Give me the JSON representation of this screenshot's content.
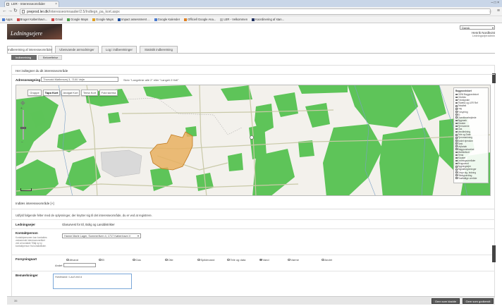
{
  "browser": {
    "tab_title": "LER - Interesseområder",
    "tab_close": "×",
    "window_controls": "–  □  ×",
    "url_host": "preprod.ler.dk",
    "url_path": "/Interesseomraader/2.5/Indtegn_pa_kort.aspx",
    "star": "☆",
    "menu": "≡",
    "bookmarks": [
      {
        "label": "Apps",
        "color": "#4a7bd0"
      },
      {
        "label": "Bruger København...",
        "color": "#d04a4a"
      },
      {
        "label": "Gmail",
        "color": "#d04a4a"
      },
      {
        "label": "Google Maps",
        "color": "#4aa04a"
      },
      {
        "label": "Google Maps",
        "color": "#e0a020"
      },
      {
        "label": "Impact assessment ...",
        "color": "#2050a0"
      },
      {
        "label": "Google Kalender",
        "color": "#4a7bd0"
      },
      {
        "label": "Officiell Google Ana...",
        "color": "#e08020"
      },
      {
        "label": "LER - Velkommen",
        "color": "#bbbbbb"
      },
      {
        "label": "Koordinering af stan...",
        "color": "#203060"
      }
    ]
  },
  "header": {
    "logo_text": "Ledningsejere",
    "language": "Dansk",
    "user_name": "Henrik Nordkvist",
    "user_role": "Ledningsejeradmin"
  },
  "main_tabs": [
    {
      "label": "Indberetning af interesseområder",
      "active": true
    },
    {
      "label": "Ubesvarede anmodninger",
      "active": false
    },
    {
      "label": "Log i indberetninger",
      "active": false
    },
    {
      "label": "Statistik indberetning",
      "active": false
    }
  ],
  "steps": [
    {
      "label": "Indberetning",
      "state": "done"
    },
    {
      "label": "Bekræftelse",
      "state": "current"
    }
  ],
  "page": {
    "instruction": "Her indtegner du dit interesseområde",
    "address_label": "Adressesøgning",
    "address_value": "Thorvald Møllersvej 3, 7100 Vejle",
    "address_hint": "Skriv \"Langelinie allé 2\" eller \"Langeli 2 Hell\"",
    "show_areas": "Indlæs interesseområde [+]",
    "info_text": "Udfyld følgende felter med de oplysninger, der knytter sig til det interesseområde, du er ved at registrere."
  },
  "map": {
    "types": [
      "Gruppe",
      "Topo Kort",
      "Andgat Kort",
      "Tema Kort",
      "Fold skema"
    ],
    "active_type": "Topo Kort",
    "pan_icon": "✥",
    "zoom_plus": "+",
    "zoom_minus": "−",
    "zoom_level": 0.4,
    "layers_header": "Baggrundskort",
    "layers_header2": "Lag",
    "layers": [
      "GDW Baggrundskort",
      "Ortofoto",
      "Fotosignale",
      "Tilvæks og LER Ref",
      "Tekstfelt",
      "Lag",
      "Forsyning",
      "El",
      "Grøntforarbejdede",
      "Bygmark",
      "Kloaker",
      "Fjernvarme",
      "Gas",
      "Vandledning",
      "Tele og Data",
      "Fjernmarkning",
      "Andet ejendom",
      "Tank",
      "Vejforløb",
      "Baggrundsvekst",
      "Matrikelkort",
      "Tema",
      "Kloaker",
      "Ledningsområder",
      "Brugsvand",
      "Bygningsejer",
      "Signalforgreninger",
      "Drivpr sig. ledning",
      "Rådsgrundlag",
      "Rustfattige område"
    ]
  },
  "form": {
    "owner_label": "Ledningsejer",
    "owner_value": "Glasurvest for El, Bolig og Landdistrikter",
    "contact_label": "Kontaktperson",
    "contact_desc": "Kontaktpersonen kan kontaktes vedrørende interesseområdet ved at kontakte Tilføj ny ny kontaktperson fra kontaktlisten",
    "contact_value": "Hanne Marie Lager, Sommerliven 4, 1717 København V",
    "supply_label": "Forsyningsart",
    "supply_options": [
      {
        "label": "Afvand",
        "selected": false
      },
      {
        "label": "El",
        "selected": false
      },
      {
        "label": "Gas",
        "selected": false
      },
      {
        "label": "Olie",
        "selected": false
      },
      {
        "label": "Spildevand",
        "selected": false
      },
      {
        "label": "Tele og data",
        "selected": false
      },
      {
        "label": "Vand",
        "selected": true
      },
      {
        "label": "Varme",
        "selected": false
      },
      {
        "label": "Andet",
        "selected": false
      }
    ],
    "other_label": "Andet",
    "remarks_label": "Bemærkninger",
    "remarks_value": "Hvidmand / Lauf ved d"
  },
  "footer": {
    "page_index": "35",
    "save_draft": "Gem som kladde",
    "save_final": "Gem som godkendt"
  },
  "colors": {
    "forest": "#5ec459",
    "field": "#f3f1ec",
    "area": "#e8b060",
    "area_stroke": "#c07a20",
    "road": "#c9c9a8",
    "stream": "#7aa0c8"
  }
}
